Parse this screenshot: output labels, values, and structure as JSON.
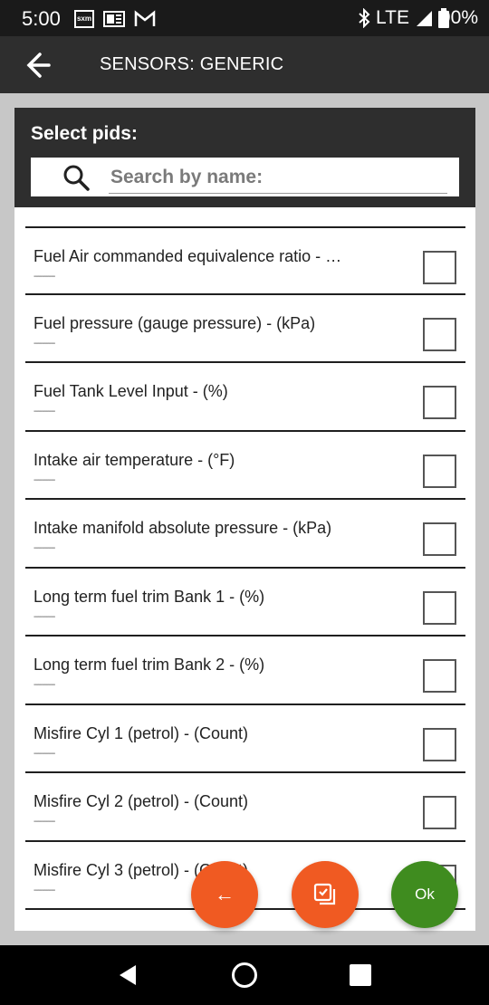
{
  "status_bar": {
    "time": "5:00",
    "sxm_label": "sxm",
    "network": "LTE",
    "battery": "90%"
  },
  "app_bar": {
    "title": "SENSORS: GENERIC"
  },
  "dialog": {
    "title": "Select pids:",
    "search": {
      "placeholder": "Search by name:",
      "value": ""
    },
    "items": [
      {
        "label": "Fuel Air commanded equivalence ratio - …",
        "sub": "----------",
        "checked": false
      },
      {
        "label": "Fuel pressure (gauge pressure) - (kPa)",
        "sub": "----------",
        "checked": false
      },
      {
        "label": "Fuel Tank Level Input - (%)",
        "sub": "----------",
        "checked": false
      },
      {
        "label": "Intake air temperature - (°F)",
        "sub": "----------",
        "checked": false
      },
      {
        "label": "Intake manifold absolute pressure - (kPa)",
        "sub": "----------",
        "checked": false
      },
      {
        "label": "Long term fuel trim Bank 1 - (%)",
        "sub": "----------",
        "checked": false
      },
      {
        "label": "Long term fuel trim Bank 2 - (%)",
        "sub": "----------",
        "checked": false
      },
      {
        "label": "Misfire Cyl 1 (petrol) - (Count)",
        "sub": "----------",
        "checked": false
      },
      {
        "label": "Misfire Cyl 2 (petrol) - (Count)",
        "sub": "----------",
        "checked": false
      },
      {
        "label": "Misfire Cyl 3 (petrol) - (Count)",
        "sub": "----------",
        "checked": false
      }
    ]
  },
  "fabs": {
    "back_label": "←",
    "select_all_icon": "select-all-icon",
    "ok_label": "Ok"
  },
  "colors": {
    "fab_orange": "#f05a22",
    "fab_green": "#3f8c1f",
    "header_dark": "#2e2e2e"
  }
}
